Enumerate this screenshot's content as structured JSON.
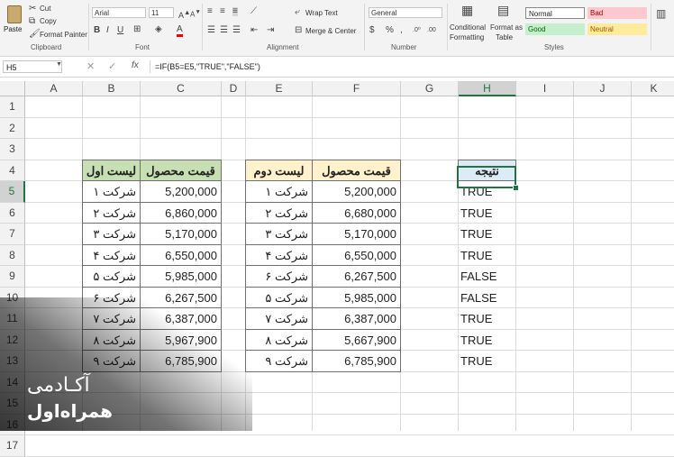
{
  "ribbon": {
    "clipboard": {
      "paste": "Paste",
      "cut": "Cut",
      "copy": "Copy",
      "format_painter": "Format Painter",
      "label": "Clipboard"
    },
    "font": {
      "name": "Arial",
      "size": "11",
      "label": "Font"
    },
    "alignment": {
      "wrap_text": "Wrap Text",
      "merge_center": "Merge & Center",
      "label": "Alignment"
    },
    "number": {
      "format": "General",
      "label": "Number"
    },
    "styles": {
      "conditional_formatting_1": "Conditional",
      "conditional_formatting_2": "Formatting",
      "format_as_table_1": "Format as",
      "format_as_table_2": "Table",
      "normal": "Normal",
      "bad": "Bad",
      "good": "Good",
      "neutral": "Neutral",
      "label": "Styles"
    }
  },
  "formula_bar": {
    "name_box": "H5",
    "fx": "fx",
    "formula": "=IF(B5=E5,\"TRUE\",\"FALSE\")"
  },
  "columns": [
    "A",
    "B",
    "C",
    "D",
    "E",
    "F",
    "G",
    "H",
    "I",
    "J",
    "K"
  ],
  "rows": [
    "1",
    "2",
    "3",
    "4",
    "5",
    "6",
    "7",
    "8",
    "9",
    "10",
    "11",
    "12",
    "13",
    "14",
    "15",
    "16",
    "17"
  ],
  "table1": {
    "header_b": "لیست اول",
    "header_c": "قیمت محصول",
    "rows": [
      [
        "شرکت ۱",
        "5,200,000"
      ],
      [
        "شرکت ۲",
        "6,860,000"
      ],
      [
        "شرکت ۳",
        "5,170,000"
      ],
      [
        "شرکت ۴",
        "6,550,000"
      ],
      [
        "شرکت ۵",
        "5,985,000"
      ],
      [
        "شرکت ۶",
        "6,267,500"
      ],
      [
        "شرکت ۷",
        "6,387,000"
      ],
      [
        "شرکت ۸",
        "5,967,900"
      ],
      [
        "شرکت ۹",
        "6,785,900"
      ]
    ]
  },
  "table2": {
    "header_e": "لیست دوم",
    "header_f": "قیمت محصول",
    "rows": [
      [
        "شرکت ۱",
        "5,200,000"
      ],
      [
        "شرکت ۲",
        "6,680,000"
      ],
      [
        "شرکت ۳",
        "5,170,000"
      ],
      [
        "شرکت ۴",
        "6,550,000"
      ],
      [
        "شرکت ۶",
        "6,267,500"
      ],
      [
        "شرکت ۵",
        "5,985,000"
      ],
      [
        "شرکت ۷",
        "6,387,000"
      ],
      [
        "شرکت ۸",
        "5,667,900"
      ],
      [
        "شرکت ۹",
        "6,785,900"
      ]
    ]
  },
  "result": {
    "header": "نتیجه",
    "values": [
      "TRUE",
      "TRUE",
      "TRUE",
      "TRUE",
      "FALSE",
      "FALSE",
      "TRUE",
      "TRUE",
      "TRUE"
    ]
  },
  "watermark": {
    "line1": "آکـادمی",
    "line2": "همراه‌اول"
  },
  "colors": {
    "green_header": "#c6e0b4",
    "yellow_header": "#fff2cc",
    "blue_header": "#ddebf7",
    "excel_green": "#217346"
  }
}
